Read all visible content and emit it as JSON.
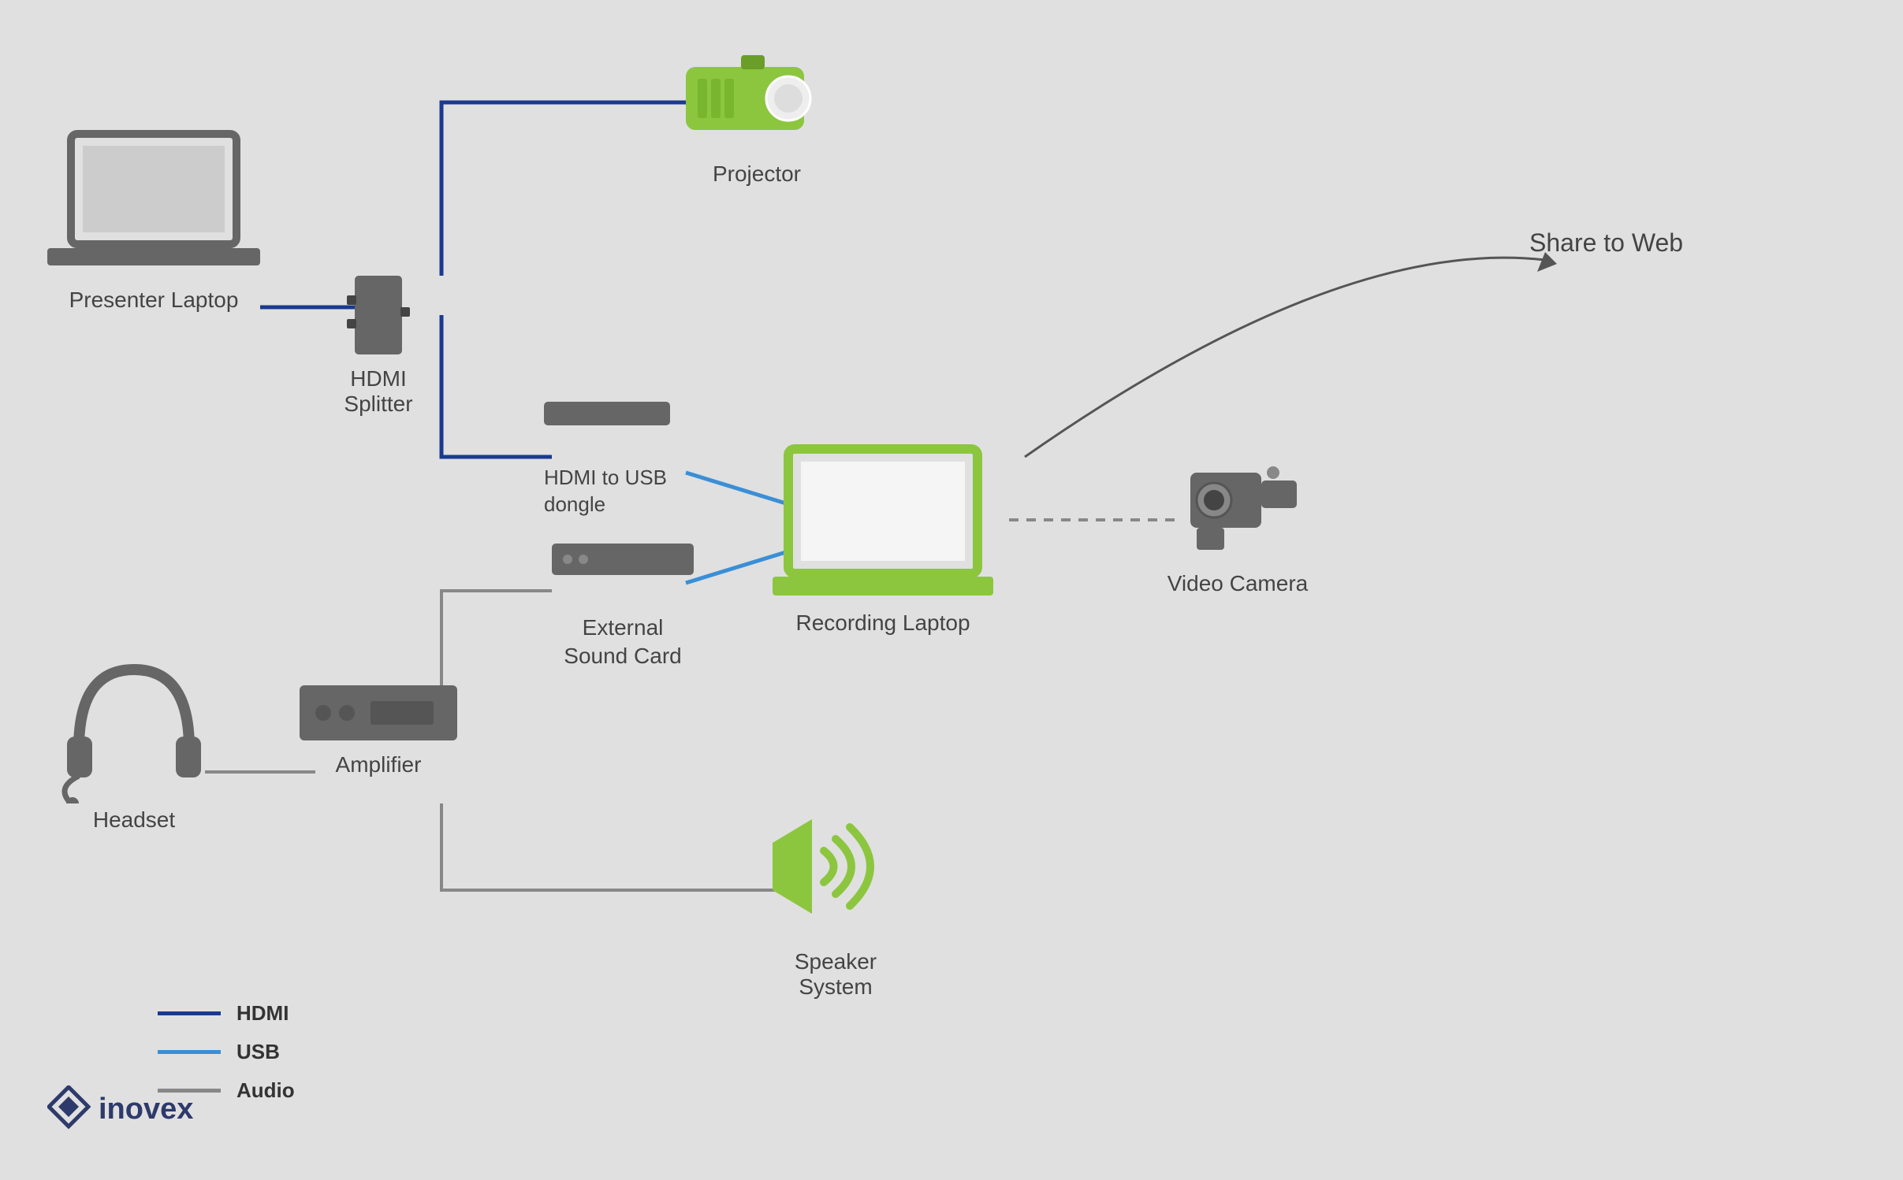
{
  "devices": {
    "presenter_laptop": {
      "label": "Presenter Laptop"
    },
    "hdmi_splitter": {
      "label": "HDMI Splitter"
    },
    "projector": {
      "label": "Projector"
    },
    "hdmi_usb_dongle": {
      "label": "HDMI to USB\ndongle"
    },
    "ext_sound_card": {
      "label": "External\nSound Card"
    },
    "recording_laptop": {
      "label": "Recording Laptop"
    },
    "video_camera": {
      "label": "Video Camera"
    },
    "headset": {
      "label": "Headset"
    },
    "amplifier": {
      "label": "Amplifier"
    },
    "speaker_system": {
      "label": "Speaker System"
    },
    "share_to_web": {
      "label": "Share to Web"
    }
  },
  "legend": {
    "hdmi": {
      "label": "HDMI",
      "color": "#1a3a8f"
    },
    "usb": {
      "label": "USB",
      "color": "#3a8fd6"
    },
    "audio": {
      "label": "Audio",
      "color": "#888888"
    }
  },
  "colors": {
    "green": "#8cc63f",
    "dark_gray": "#555555",
    "mid_gray": "#666666",
    "hdmi_blue": "#1a3a8f",
    "usb_blue": "#3a8fd6",
    "audio_gray": "#888888"
  },
  "logo": {
    "text": "inovex"
  }
}
